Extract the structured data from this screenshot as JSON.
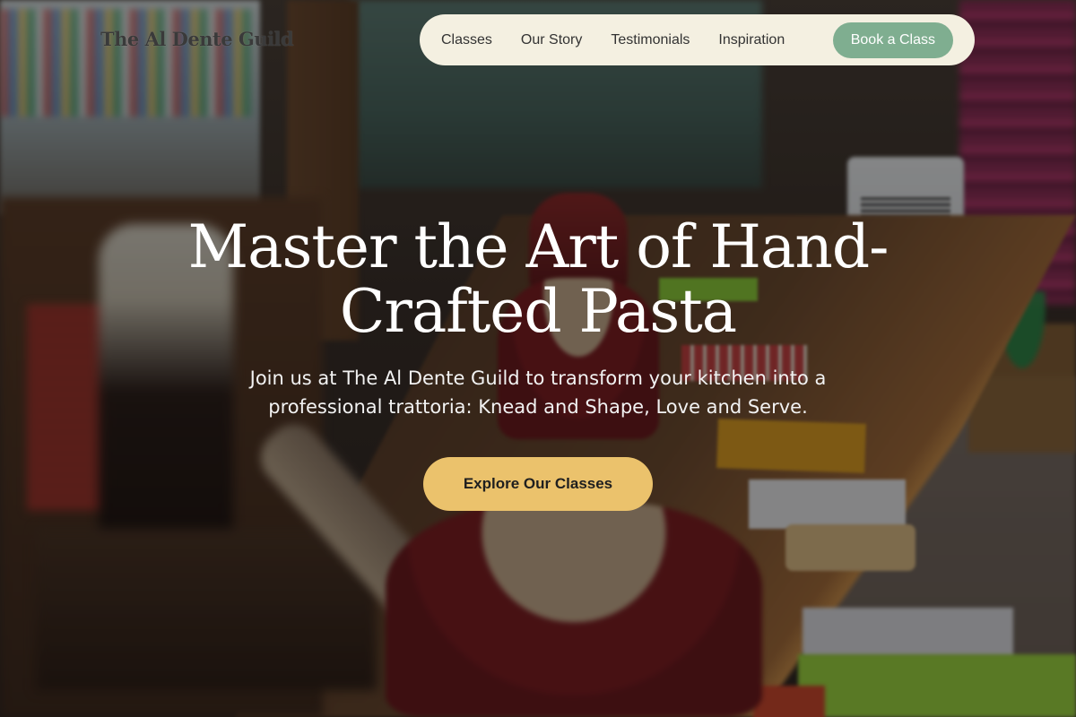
{
  "brand": {
    "name": "The Al Dente Guild"
  },
  "nav": {
    "links": [
      "Classes",
      "Our Story",
      "Testimonials",
      "Inspiration"
    ],
    "cta_label": "Book a Class"
  },
  "hero": {
    "title": "Master the Art of Hand-Crafted Pasta",
    "subtitle": "Join us at The Al Dente Guild to transform your kitchen into a professional trattoria: Knead and Shape, Love and Serve.",
    "cta_label": "Explore Our Classes"
  },
  "colors": {
    "nav_background": "#f4f0e1",
    "nav_cta": "#7fae90",
    "hero_cta": "#ebc26c",
    "overlay": "rgba(0,0,0,0.42)"
  },
  "background_image": {
    "description_icon": "kitchen-photo"
  }
}
